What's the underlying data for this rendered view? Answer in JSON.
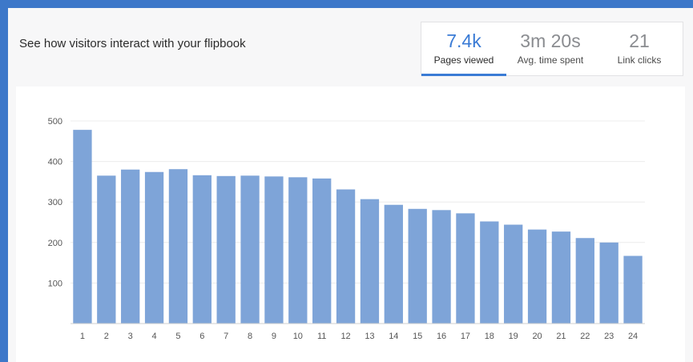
{
  "header": {
    "title": "See how visitors interact with your flipbook"
  },
  "tabs": [
    {
      "value": "7.4k",
      "label": "Pages viewed",
      "active": true
    },
    {
      "value": "3m 20s",
      "label": "Avg. time spent",
      "active": false
    },
    {
      "value": "21",
      "label": "Link clicks",
      "active": false
    }
  ],
  "colors": {
    "accent": "#3a7bd5",
    "bar": "#7ea4d8",
    "frame": "#3d78c9"
  },
  "chart_data": {
    "type": "bar",
    "categories": [
      "1",
      "2",
      "3",
      "4",
      "5",
      "6",
      "7",
      "8",
      "9",
      "10",
      "11",
      "12",
      "13",
      "14",
      "15",
      "16",
      "17",
      "18",
      "19",
      "20",
      "21",
      "22",
      "23",
      "24"
    ],
    "values": [
      478,
      365,
      380,
      374,
      381,
      366,
      364,
      365,
      363,
      361,
      358,
      331,
      307,
      293,
      283,
      280,
      272,
      252,
      244,
      232,
      227,
      211,
      200,
      167
    ],
    "yticks": [
      "100",
      "200",
      "300",
      "400",
      "500"
    ],
    "ylim": [
      0,
      500
    ],
    "grid": true
  }
}
